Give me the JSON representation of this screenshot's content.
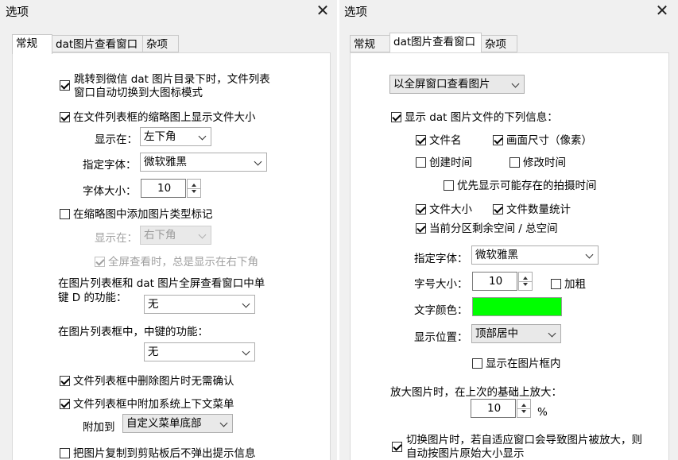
{
  "left": {
    "title": "选项",
    "tabs": [
      "常规",
      "dat图片查看窗口",
      "杂项"
    ],
    "active_tab": 0,
    "auto_large_icon": "跳转到微信 dat 图片目录下时，文件列表窗口自动切换到大图标模式",
    "show_file_size": "在文件列表框的缩略图上显示文件大小",
    "show_at_label": "显示在：",
    "show_at_value": "左下角",
    "font_label": "指定字体：",
    "font_value": "微软雅黑",
    "font_size_label": "字体大小：",
    "font_size_value": "10",
    "add_type_mark": "在缩略图中添加图片类型标记",
    "mark_show_at_label": "显示在：",
    "mark_show_at_value": "右下角",
    "fullscreen_bottom_right": "全屏查看时，总是显示在右下角",
    "key_d_label": "在图片列表框和 dat 图片全屏查看窗口中单键 D 的功能：",
    "key_d_value": "无",
    "middle_click_label": "在图片列表框中，中键的功能：",
    "middle_click_value": "无",
    "delete_no_confirm": "文件列表框中删除图片时无需确认",
    "attach_context_menu": "文件列表框中附加系统上下文菜单",
    "attach_to_label": "附加到",
    "attach_to_value": "自定义菜单底部",
    "no_copy_prompt": "把图片复制到剪贴板后不弹出提示信息"
  },
  "right": {
    "title": "选项",
    "tabs": [
      "常规",
      "dat图片查看窗口",
      "杂项"
    ],
    "active_tab": 1,
    "view_mode_value": "以全屏窗口查看图片",
    "show_info": "显示 dat 图片文件的下列信息：",
    "file_name": "文件名",
    "image_size": "画面尺寸（像素）",
    "create_time": "创建时间",
    "modify_time": "修改时间",
    "shot_time_first": "优先显示可能存在的拍摄时间",
    "file_size": "文件大小",
    "file_count": "文件数量统计",
    "partition_space": "当前分区剩余空间 / 总空间",
    "font_label": "指定字体：",
    "font_value": "微软雅黑",
    "size_label": "字号大小：",
    "size_value": "10",
    "bold": "加粗",
    "color_label": "文字颜色：",
    "text_color": "#00ff00",
    "position_label": "显示位置：",
    "position_value": "顶部居中",
    "inside_frame": "显示在图片框内",
    "zoom_label": "放大图片时，在上次的基础上放大：",
    "zoom_value": "10",
    "zoom_unit": "%",
    "original_size": "切换图片时，若自适应窗口会导致图片被放大，则自动按图片原始大小显示"
  }
}
